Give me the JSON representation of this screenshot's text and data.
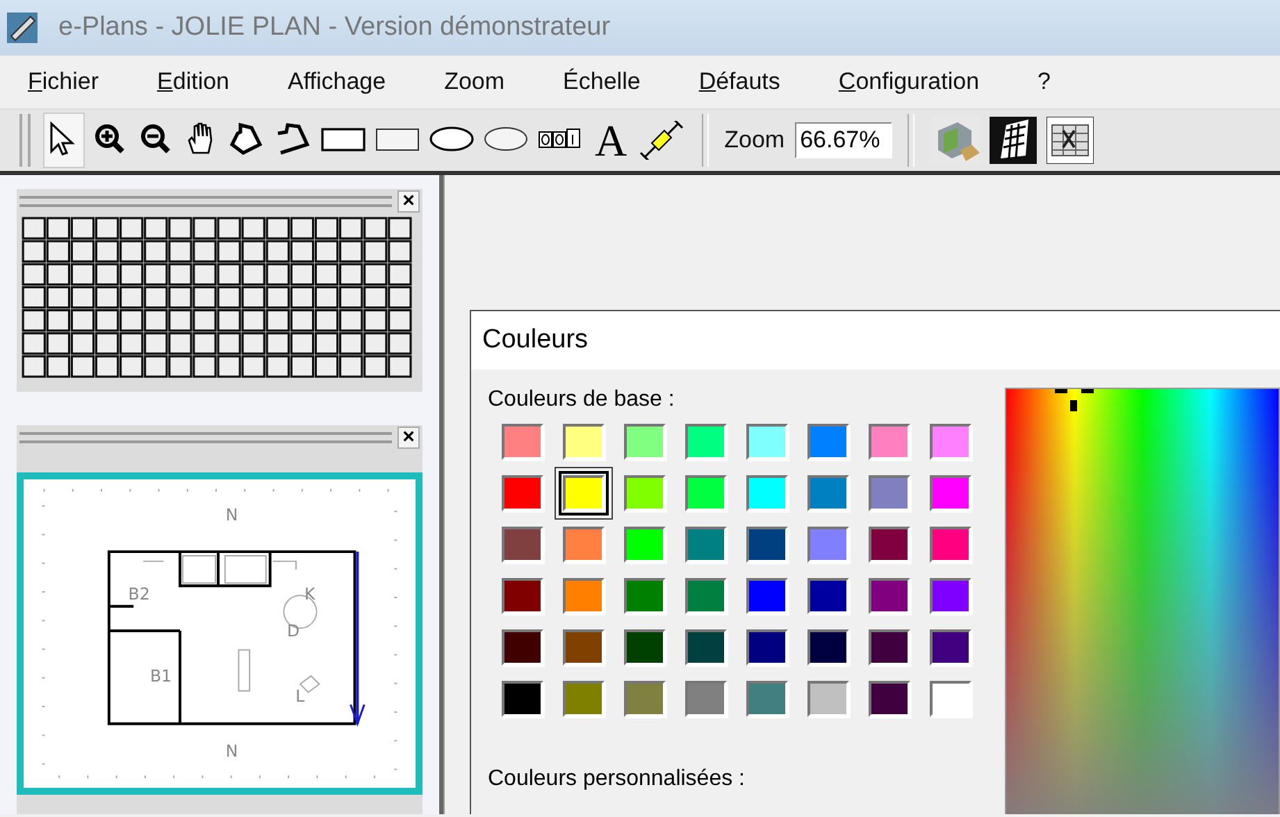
{
  "window": {
    "title": "e-Plans - JOLIE PLAN - Version démonstrateur"
  },
  "menu": [
    {
      "label": "Fichier",
      "mnemonic": true
    },
    {
      "label": "Edition",
      "mnemonic": true
    },
    {
      "label": "Affichage",
      "mnemonic": false
    },
    {
      "label": "Zoom",
      "mnemonic": false
    },
    {
      "label": "Échelle",
      "mnemonic": false
    },
    {
      "label": "Défauts",
      "mnemonic": true
    },
    {
      "label": "Configuration",
      "mnemonic": true
    },
    {
      "label": "?",
      "mnemonic": false
    }
  ],
  "toolbar": {
    "tools": [
      {
        "kind": "pointer",
        "selected": true
      },
      {
        "kind": "zoom-in",
        "selected": false
      },
      {
        "kind": "zoom-out",
        "selected": false
      },
      {
        "kind": "hand",
        "selected": false
      },
      {
        "kind": "polygon",
        "selected": false
      },
      {
        "kind": "polyline",
        "selected": false
      },
      {
        "kind": "rectangle",
        "selected": false
      },
      {
        "kind": "rectangle-thin",
        "selected": false
      },
      {
        "kind": "ellipse",
        "selected": false
      },
      {
        "kind": "ellipse-thin",
        "selected": false
      },
      {
        "kind": "counter",
        "selected": false
      },
      {
        "kind": "text",
        "glyph": "A",
        "selected": false
      },
      {
        "kind": "dimension",
        "selected": false
      }
    ],
    "zoom_label": "Zoom",
    "zoom_value": "66.67%",
    "actions": [
      {
        "kind": "render"
      },
      {
        "kind": "view-3d"
      },
      {
        "kind": "sheet"
      }
    ]
  },
  "panels": [
    {
      "kind": "grid",
      "close": "×"
    },
    {
      "kind": "plan",
      "close": "×",
      "labels": [
        "N",
        "B2",
        "K",
        "D",
        "B1",
        "L",
        "N"
      ]
    }
  ],
  "dialog": {
    "title": "Couleurs",
    "basic_label": "Couleurs de base :",
    "custom_label": "Couleurs personnalisées :",
    "swatches": [
      {
        "color": "#ff8080",
        "selected": false
      },
      {
        "color": "#ffff80",
        "selected": false
      },
      {
        "color": "#80ff80",
        "selected": false
      },
      {
        "color": "#00ff80",
        "selected": false
      },
      {
        "color": "#80ffff",
        "selected": false
      },
      {
        "color": "#0080ff",
        "selected": false
      },
      {
        "color": "#ff80c0",
        "selected": false
      },
      {
        "color": "#ff80ff",
        "selected": false
      },
      {
        "color": "#ff0000",
        "selected": false
      },
      {
        "color": "#ffff00",
        "selected": true
      },
      {
        "color": "#80ff00",
        "selected": false
      },
      {
        "color": "#00ff40",
        "selected": false
      },
      {
        "color": "#00ffff",
        "selected": false
      },
      {
        "color": "#0080c0",
        "selected": false
      },
      {
        "color": "#8080c0",
        "selected": false
      },
      {
        "color": "#ff00ff",
        "selected": false
      },
      {
        "color": "#804040",
        "selected": false
      },
      {
        "color": "#ff8040",
        "selected": false
      },
      {
        "color": "#00ff00",
        "selected": false
      },
      {
        "color": "#008080",
        "selected": false
      },
      {
        "color": "#004080",
        "selected": false
      },
      {
        "color": "#8080ff",
        "selected": false
      },
      {
        "color": "#800040",
        "selected": false
      },
      {
        "color": "#ff0080",
        "selected": false
      },
      {
        "color": "#800000",
        "selected": false
      },
      {
        "color": "#ff8000",
        "selected": false
      },
      {
        "color": "#008000",
        "selected": false
      },
      {
        "color": "#008040",
        "selected": false
      },
      {
        "color": "#0000ff",
        "selected": false
      },
      {
        "color": "#0000a0",
        "selected": false
      },
      {
        "color": "#800080",
        "selected": false
      },
      {
        "color": "#8000ff",
        "selected": false
      },
      {
        "color": "#400000",
        "selected": false
      },
      {
        "color": "#804000",
        "selected": false
      },
      {
        "color": "#004000",
        "selected": false
      },
      {
        "color": "#004040",
        "selected": false
      },
      {
        "color": "#000080",
        "selected": false
      },
      {
        "color": "#000040",
        "selected": false
      },
      {
        "color": "#400040",
        "selected": false
      },
      {
        "color": "#400080",
        "selected": false
      },
      {
        "color": "#000000",
        "selected": false
      },
      {
        "color": "#808000",
        "selected": false
      },
      {
        "color": "#808040",
        "selected": false
      },
      {
        "color": "#808080",
        "selected": false
      },
      {
        "color": "#408080",
        "selected": false
      },
      {
        "color": "#c0c0c0",
        "selected": false
      },
      {
        "color": "#400040",
        "selected": false
      },
      {
        "color": "#ffffff",
        "selected": false
      }
    ]
  }
}
